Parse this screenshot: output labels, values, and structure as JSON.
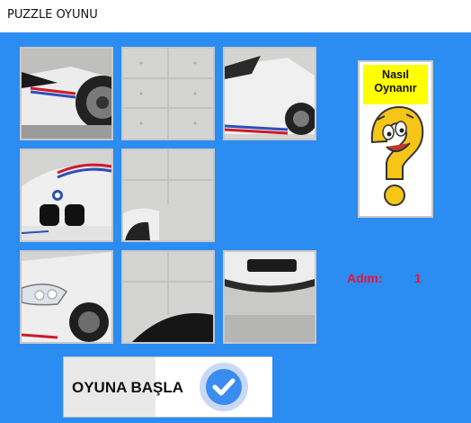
{
  "window": {
    "title": "PUZZLE OYUNU"
  },
  "board": {
    "tiles": [
      {
        "index": 1,
        "piece": "car-front-wheel",
        "empty": false
      },
      {
        "index": 2,
        "piece": "concrete-wall",
        "empty": false
      },
      {
        "index": 3,
        "piece": "car-rear-side",
        "empty": false
      },
      {
        "index": 4,
        "piece": "car-kidney-grille",
        "empty": false
      },
      {
        "index": 5,
        "piece": "concrete-wall-wheel-arch",
        "empty": false
      },
      {
        "index": 6,
        "piece": "",
        "empty": true
      },
      {
        "index": 7,
        "piece": "car-headlight",
        "empty": false
      },
      {
        "index": 8,
        "piece": "concrete-wall-tire",
        "empty": false
      },
      {
        "index": 9,
        "piece": "car-bumper",
        "empty": false
      }
    ]
  },
  "help": {
    "line1": "Nasıl",
    "line2": "Oynanır",
    "icon": "question-mark-character-icon"
  },
  "steps": {
    "label": "Adım:",
    "value": "1"
  },
  "start_button": {
    "label": "OYUNA BAŞLA",
    "icon": "checkmark-circle-icon"
  },
  "colors": {
    "background": "#2b8cf2",
    "accent_text": "#ee1133",
    "help_banner": "#ffff00",
    "check_circle": "#3a8cf0"
  }
}
